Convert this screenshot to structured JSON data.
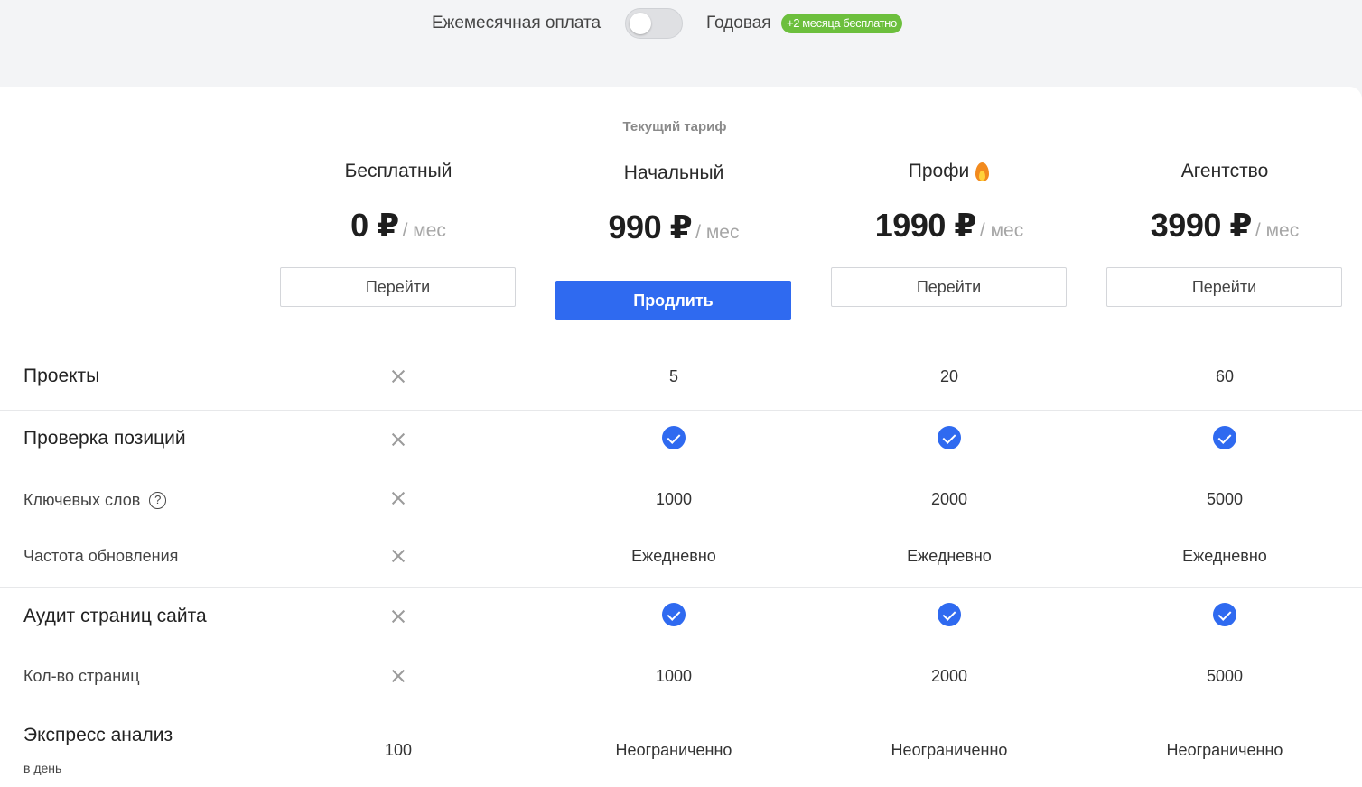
{
  "billing": {
    "monthly_label": "Ежемесячная оплата",
    "yearly_label": "Годовая",
    "promo_badge": "+2 месяца бесплатно",
    "toggle_state": "monthly"
  },
  "current_plan_label": "Текущий тариф",
  "plans": [
    {
      "name": "Бесплатный",
      "price": "0 ₽",
      "period": "/ мес",
      "button": "Перейти"
    },
    {
      "name": "Начальный",
      "price": "990 ₽",
      "period": "/ мес",
      "button": "Продлить"
    },
    {
      "name": "Профи",
      "price": "1990 ₽",
      "period": "/ мес",
      "button": "Перейти",
      "icon": "fire-icon"
    },
    {
      "name": "Агентство",
      "price": "3990 ₽",
      "period": "/ мес",
      "button": "Перейти"
    }
  ],
  "rows": {
    "projects": {
      "label": "Проекты",
      "values": [
        "x",
        "5",
        "20",
        "60"
      ]
    },
    "positions": {
      "label": "Проверка позиций",
      "values": [
        "x",
        "check",
        "check",
        "check"
      ]
    },
    "keywords": {
      "label": "Ключевых слов",
      "values": [
        "x",
        "1000",
        "2000",
        "5000"
      ],
      "icon": "help-icon"
    },
    "frequency": {
      "label": "Частота обновления",
      "values": [
        "x",
        "Ежедневно",
        "Ежедневно",
        "Ежедневно"
      ]
    },
    "audit": {
      "label": "Аудит страниц сайта",
      "values": [
        "x",
        "check",
        "check",
        "check"
      ]
    },
    "pages": {
      "label": "Кол-во страниц",
      "values": [
        "x",
        "1000",
        "2000",
        "5000"
      ]
    },
    "express": {
      "label": "Экспресс анализ",
      "hint": "в день",
      "values": [
        "100",
        "Неограниченно",
        "Неограниченно",
        "Неограниченно"
      ]
    }
  },
  "colors": {
    "accent": "#2f6af0",
    "promo": "#6cbf3d",
    "background": "#f3f4f6",
    "x_icon": "#9b9b9b"
  }
}
